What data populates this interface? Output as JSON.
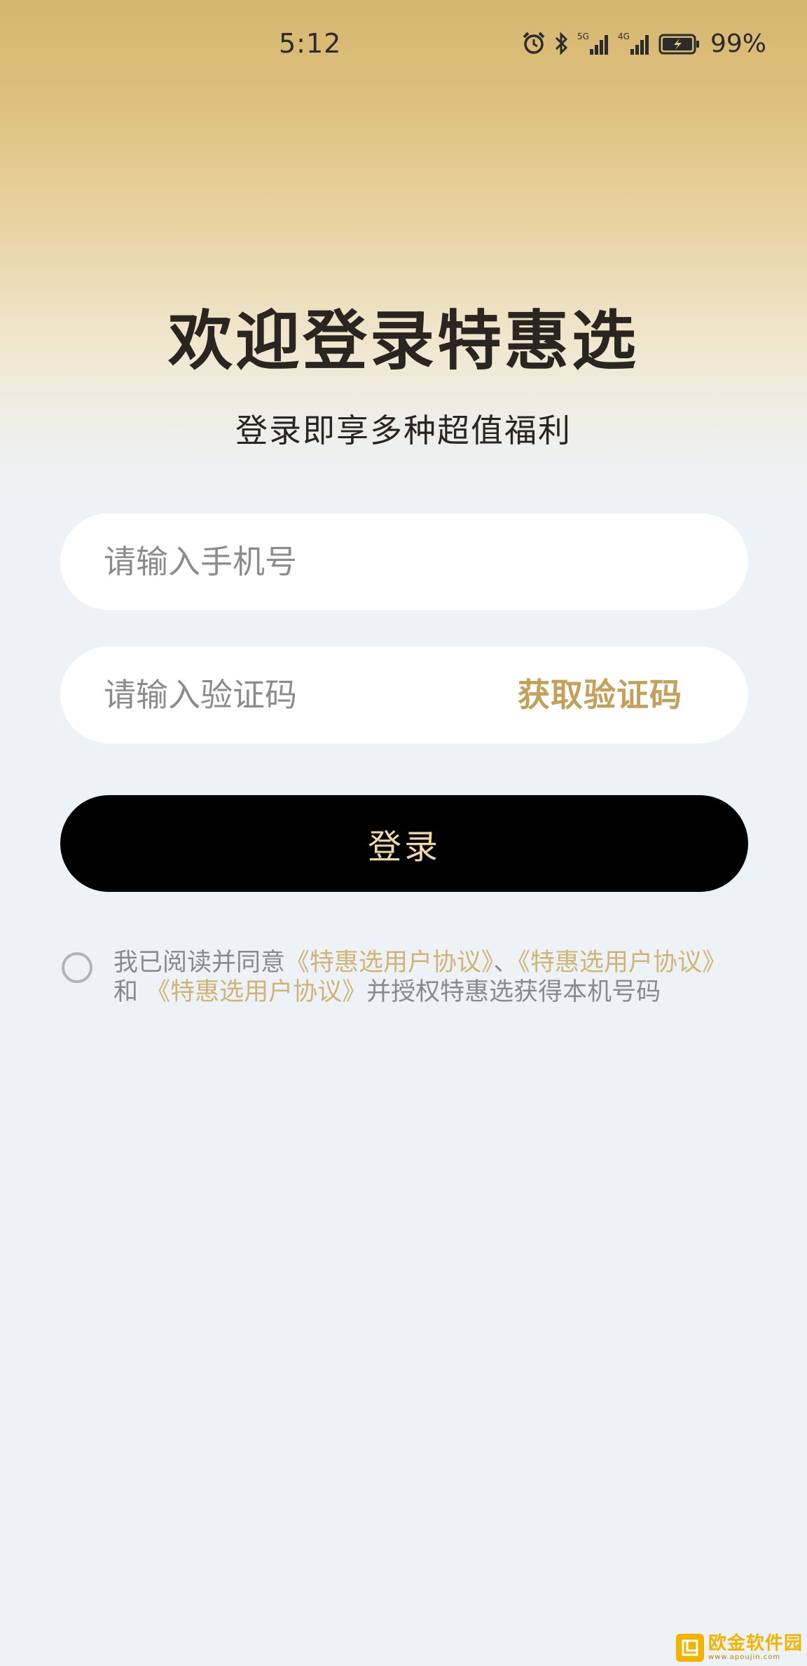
{
  "status_bar": {
    "time": "5:12",
    "icons": [
      "alarm-icon",
      "bluetooth-icon",
      "signal-5g-icon",
      "signal-4g-icon",
      "battery-charging-icon"
    ],
    "net_5g": "5G",
    "net_4g": "4G",
    "battery": "99%"
  },
  "header": {
    "title": "欢迎登录特惠选",
    "subtitle": "登录即享多种超值福利"
  },
  "form": {
    "phone_placeholder": "请输入手机号",
    "code_placeholder": "请输入验证码",
    "get_code_label": "获取验证码",
    "login_label": "登录"
  },
  "agreement": {
    "checked": false,
    "prefix": "我已阅读并同意",
    "link1": "《特惠选用户协议》",
    "sep": "、",
    "link2": "《特惠选用户协议》",
    "and": "和",
    "link3": "《特惠选用户协议》",
    "suffix": "并授权特惠选获得本机号码"
  },
  "watermark": {
    "title": "欧金软件园",
    "subtitle": "www.apoujin.com"
  },
  "colors": {
    "accent_gold": "#c3a15a",
    "link_gold": "#d0b476",
    "button_bg": "#000000",
    "button_text": "#f0d9a6"
  }
}
